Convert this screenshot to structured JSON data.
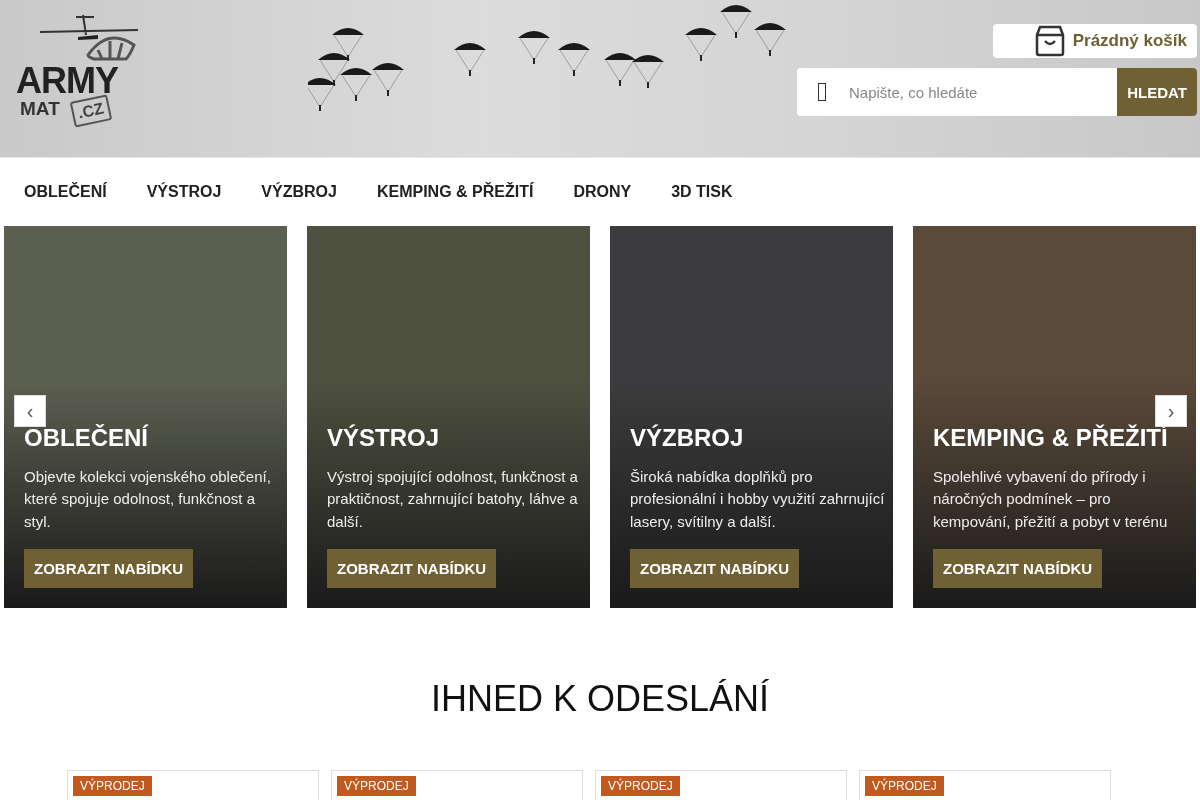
{
  "logo": {
    "word": "ARMY",
    "sub": "MAT",
    "domain": ".CZ"
  },
  "cart": {
    "label": "Prázdný košík"
  },
  "search": {
    "placeholder": "Napište, co hledáte",
    "button": "HLEDAT"
  },
  "nav": [
    "OBLEČENÍ",
    "VÝSTROJ",
    "VÝZBROJ",
    "KEMPING & PŘEŽITÍ",
    "DRONY",
    "3D TISK"
  ],
  "slider": {
    "prev": "‹",
    "next": "›"
  },
  "categories": [
    {
      "title": "OBLEČENÍ",
      "text": "Objevte kolekci vojenského oblečení, které spojuje odolnost, funkčnost a styl.",
      "button": "ZOBRAZIT NABÍDKU",
      "color": "#5c6050"
    },
    {
      "title": "VÝSTROJ",
      "text": "Výstroj spojující odolnost, funkčnost a praktičnost, zahrnující batohy, láhve a další.",
      "button": "ZOBRAZIT NABÍDKU",
      "color": "#4e5040"
    },
    {
      "title": "VÝZBROJ",
      "text": "Široká nabídka doplňků pro profesionální i hobby využití zahrnující lasery, svítilny a další.",
      "button": "ZOBRAZIT NABÍDKU",
      "color": "#3c3c3e"
    },
    {
      "title": "KEMPING & PŘEŽITÍ",
      "text": "Spolehlivé vybavení do přírody i náročných podmínek – pro kempování, přežití a pobyt v terénu",
      "button": "ZOBRAZIT NABÍDKU",
      "color": "#5a4a3a"
    }
  ],
  "section_title": "IHNED K ODESLÁNÍ",
  "products": [
    {
      "badge": "VÝPRODEJ"
    },
    {
      "badge": "VÝPRODEJ"
    },
    {
      "badge": "VÝPRODEJ"
    },
    {
      "badge": "VÝPRODEJ"
    }
  ]
}
